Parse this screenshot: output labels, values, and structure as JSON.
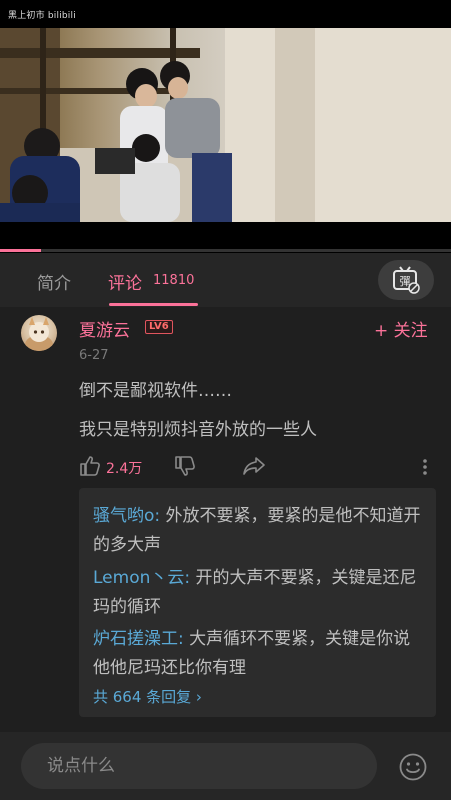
{
  "video": {
    "watermark": "黑上初市 bilibili",
    "progress_fraction": 0.09
  },
  "tabs": {
    "intro_label": "简介",
    "comments_label": "评论",
    "comments_count": "11810",
    "danmaku_icon": "danmaku-toggle-icon",
    "danmaku_glyph": "彈"
  },
  "comment": {
    "username": "夏游云",
    "level": "LV6",
    "follow_label": "+ 关注",
    "date": "6-27",
    "lines": [
      "倒不是鄙视软件……",
      "我只是特别烦抖音外放的一些人"
    ],
    "like_count": "2.4万",
    "replies": [
      {
        "name": "骚气哟o:",
        "text": " 外放不要紧，要紧的是他不知道开的多大声"
      },
      {
        "name": "Lemon丶云:",
        "text": " 开的大声不要紧，关键是还尼玛的循环"
      },
      {
        "name": "炉石搓澡工:",
        "text": " 大声循环不要紧，关键是你说他他尼玛还比你有理"
      }
    ],
    "more_replies": "共 664 条回复 ›"
  },
  "input": {
    "placeholder": "说点什么"
  },
  "colors": {
    "accent": "#fb7299",
    "reply_name": "#5aa9d6",
    "background": "#1f1f1f"
  }
}
